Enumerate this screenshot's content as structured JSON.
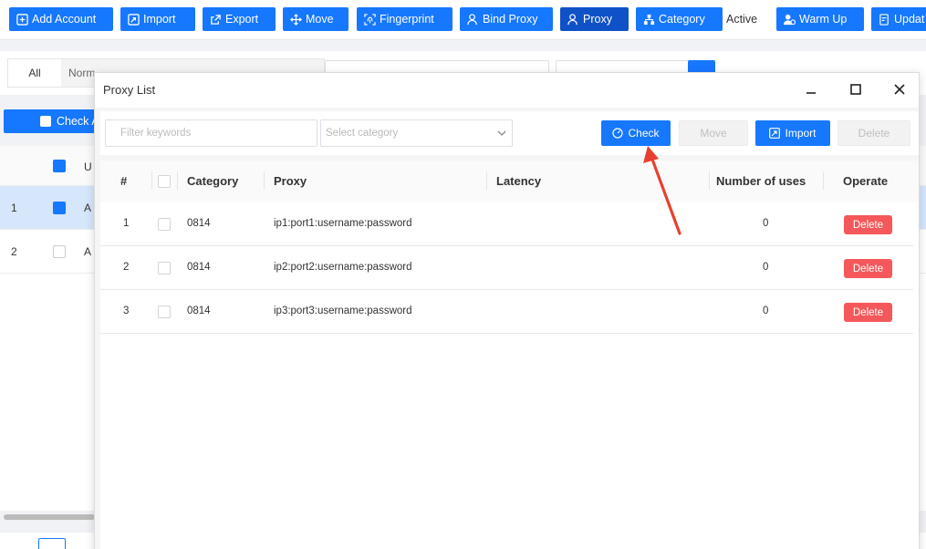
{
  "toolbar": {
    "buttons": [
      {
        "label": "Add Account",
        "icon": "plus-square-icon"
      },
      {
        "label": "Import",
        "icon": "import-icon"
      },
      {
        "label": "Export",
        "icon": "export-icon"
      },
      {
        "label": "Move",
        "icon": "move-icon"
      },
      {
        "label": "Fingerprint",
        "icon": "fingerprint-icon"
      },
      {
        "label": "Bind Proxy",
        "icon": "bind-proxy-icon"
      },
      {
        "label": "Proxy",
        "icon": "proxy-icon"
      },
      {
        "label": "Category",
        "icon": "category-icon"
      },
      {
        "label": "Warm Up",
        "icon": "warm-up-icon"
      },
      {
        "label": "Updat",
        "icon": "update-icon"
      }
    ],
    "active_text": "Active"
  },
  "filter_bar": {
    "tabs": [
      "All",
      "Norm"
    ]
  },
  "check_all_label": "Check A",
  "background_table": {
    "header_partial": "U",
    "rows": [
      {
        "index": "1",
        "text": "A",
        "checked": true
      },
      {
        "index": "2",
        "text": "A",
        "checked": false
      }
    ]
  },
  "modal": {
    "title": "Proxy List",
    "filter_placeholder": "Filter keywords",
    "category_placeholder": "Select category",
    "buttons": {
      "check": "Check",
      "move": "Move",
      "import": "Import",
      "delete": "Delete"
    },
    "columns": {
      "index": "#",
      "category": "Category",
      "proxy": "Proxy",
      "latency": "Latency",
      "uses": "Number of uses",
      "operate": "Operate"
    },
    "rows": [
      {
        "index": "1",
        "category": "0814",
        "proxy": "ip1:port1:username:password",
        "latency": "",
        "uses": "0",
        "action": "Delete"
      },
      {
        "index": "2",
        "category": "0814",
        "proxy": "ip2:port2:username:password",
        "latency": "",
        "uses": "0",
        "action": "Delete"
      },
      {
        "index": "3",
        "category": "0814",
        "proxy": "ip3:port3:username:password",
        "latency": "",
        "uses": "0",
        "action": "Delete"
      }
    ]
  },
  "colors": {
    "primary": "#1677ff",
    "primary_active": "#0f52c8",
    "danger": "#f4585a",
    "annotation_arrow": "#e8402f"
  }
}
